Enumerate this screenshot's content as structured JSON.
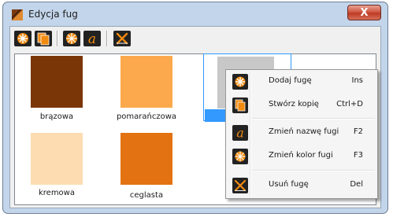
{
  "window": {
    "title": "Edycja fug",
    "close_label": "X"
  },
  "toolbar": {
    "buttons": [
      {
        "name": "add",
        "icon": "add-grout-icon"
      },
      {
        "name": "copy",
        "icon": "copy-icon"
      },
      {
        "name": "color",
        "icon": "color-wheel-icon"
      },
      {
        "name": "rename",
        "icon": "rename-icon"
      },
      {
        "name": "delete",
        "icon": "delete-icon"
      }
    ]
  },
  "grouts": [
    {
      "label": "brązowa",
      "color": "#7b3608"
    },
    {
      "label": "pomarańczowa",
      "color": "#fba94c"
    },
    {
      "label": "kremowa",
      "color": "#fddcb1"
    },
    {
      "label": "ceglasta",
      "color": "#e37212"
    },
    {
      "label": "",
      "color": "#c8c8c8",
      "selected": true
    }
  ],
  "context_menu": {
    "items": [
      {
        "label": "Dodaj fugę",
        "shortcut": "Ins",
        "icon": "add-grout-icon"
      },
      {
        "label": "Stwórz kopię",
        "shortcut": "Ctrl+D",
        "icon": "copy-icon"
      },
      {
        "label": "Zmień nazwę fugi",
        "shortcut": "F2",
        "icon": "rename-icon"
      },
      {
        "label": "Zmień kolor fugi",
        "shortcut": "F3",
        "icon": "color-wheel-icon"
      },
      {
        "label": "Usuń fugę",
        "shortcut": "Del",
        "icon": "delete-icon"
      }
    ]
  },
  "colors": {
    "accent": "#3399ff",
    "icon_orange": "#f08a10",
    "icon_dark": "#222222"
  }
}
